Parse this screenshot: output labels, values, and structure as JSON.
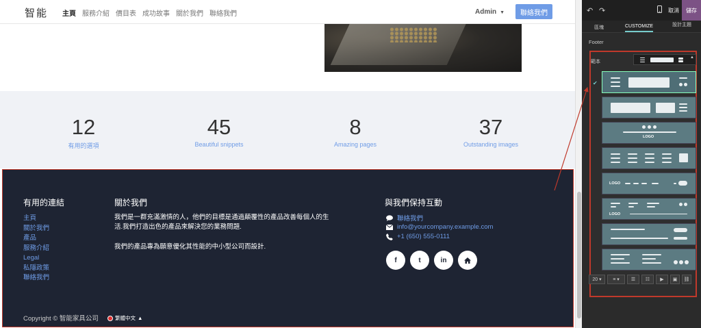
{
  "nav": {
    "logo": "智能",
    "links": [
      "主頁",
      "服務介紹",
      "價目表",
      "成功故事",
      "關於我們",
      "聯絡我們"
    ],
    "admin": "Admin",
    "cta": "聯絡我們"
  },
  "stats": [
    {
      "value": "12",
      "label": "有用的選項"
    },
    {
      "value": "45",
      "label": "Beautiful snippets"
    },
    {
      "value": "8",
      "label": "Amazing pages"
    },
    {
      "value": "37",
      "label": "Outstanding images"
    }
  ],
  "footer": {
    "links_title": "有用的連結",
    "links": [
      "主頁",
      "關於我們",
      "產品",
      "服務介紹",
      "Legal",
      "私隱政策",
      "聯絡我們"
    ],
    "about_title": "關於我們",
    "about_p1": "我們是一群充滿激情的人，他們的目標是通過顛覆性的產品改善每個人的生活.我們打造出色的產品來解決您的業務問題.",
    "about_p2": "我們的產品專為願意優化其性能的中小型公司而設計.",
    "contact_title": "與我們保持互動",
    "contact_link": "聯絡我們",
    "email": "info@yourcompany.example.com",
    "phone": "+1 (650) 555-0111",
    "social": [
      "f",
      "t",
      "in",
      "home"
    ],
    "copyright": "Copyright © 智能家具公司",
    "language": "繁體中文"
  },
  "panel": {
    "cancel": "取消",
    "save": "儲存",
    "tabs": [
      "區塊",
      "CUSTOMIZE",
      "設計主題"
    ],
    "section": "Footer",
    "template_label": "範本",
    "font_size": "20"
  },
  "templates": [
    {
      "name": "columns",
      "logo": ""
    },
    {
      "name": "contact",
      "logo": ""
    },
    {
      "name": "call-to-action",
      "logo": "LOGO"
    },
    {
      "name": "descriptions",
      "logo": ""
    },
    {
      "name": "centered",
      "logo": "LOGO"
    },
    {
      "name": "links",
      "logo": "LOGO"
    },
    {
      "name": "minimalist",
      "logo": ""
    },
    {
      "name": "headline",
      "logo": ""
    }
  ],
  "colors": {
    "accent": "#6f9ce6",
    "footer_bg": "#1e2433",
    "save": "#7c5285",
    "highlight": "#c0392b"
  }
}
